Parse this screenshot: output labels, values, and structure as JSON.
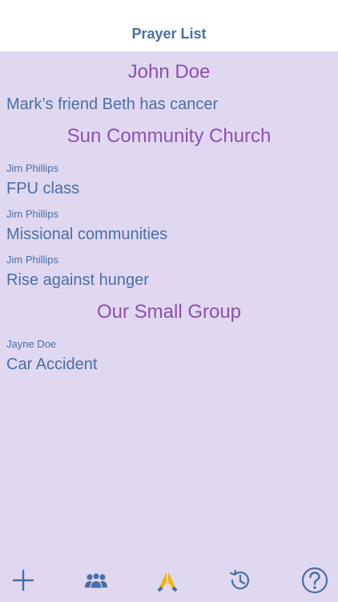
{
  "nav": {
    "title": "Prayer List"
  },
  "groups": [
    {
      "name": "John Doe",
      "requests": [
        {
          "requester": "",
          "text": "Mark’s friend Beth has cancer"
        }
      ]
    },
    {
      "name": "Sun Community Church",
      "requests": [
        {
          "requester": "Jim Phillips",
          "text": "FPU class"
        },
        {
          "requester": "Jim Phillips",
          "text": "Missional communities"
        },
        {
          "requester": "Jim Phillips",
          "text": "Rise against hunger"
        }
      ]
    },
    {
      "name": "Our Small Group",
      "requests": [
        {
          "requester": "Jayne Doe",
          "text": "Car Accident"
        }
      ]
    }
  ],
  "tabs": [
    {
      "icon": "plus-icon"
    },
    {
      "icon": "people-icon"
    },
    {
      "icon": "praying-hands-icon"
    },
    {
      "icon": "history-icon"
    },
    {
      "icon": "help-icon"
    }
  ],
  "colors": {
    "background": "#e0d8f0",
    "accent": "#4a6ea6",
    "group_header": "#8f4fb0",
    "praying_hands": "#f2b400"
  }
}
